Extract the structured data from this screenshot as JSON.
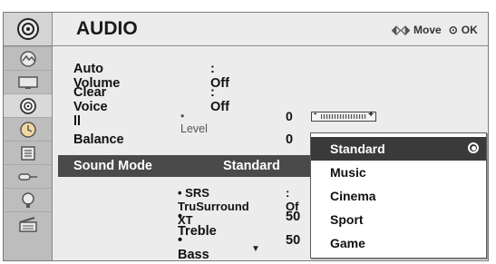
{
  "header": {
    "title": "AUDIO",
    "move_label": "Move",
    "ok_label": "OK"
  },
  "sidebar": {
    "items": [
      {
        "icon": "picture-icon"
      },
      {
        "icon": "screen-icon"
      },
      {
        "icon": "audio-icon",
        "active": true
      },
      {
        "icon": "time-icon"
      },
      {
        "icon": "option-icon"
      },
      {
        "icon": "input-icon"
      },
      {
        "icon": "lock-icon"
      },
      {
        "icon": "movie-icon"
      }
    ]
  },
  "rows": [
    {
      "label": "Auto Volume",
      "value": ": Off"
    },
    {
      "label": "Clear Voice ll",
      "value": ": Off"
    },
    {
      "label": "• Level",
      "value": "0"
    },
    {
      "label": "Balance",
      "value": "0"
    },
    {
      "label": "Sound Mode",
      "value": "Standard"
    },
    {
      "label": "• SRS TruSurround XT",
      "value": ": Of"
    },
    {
      "label": "• Treble",
      "value": "50"
    },
    {
      "label": "• Bass",
      "value": "50"
    }
  ],
  "level_slider": {
    "minus": "-",
    "plus": "+"
  },
  "sound_mode_options": [
    {
      "label": "Standard",
      "selected": true
    },
    {
      "label": "Music"
    },
    {
      "label": "Cinema"
    },
    {
      "label": "Sport"
    },
    {
      "label": "Game"
    }
  ]
}
